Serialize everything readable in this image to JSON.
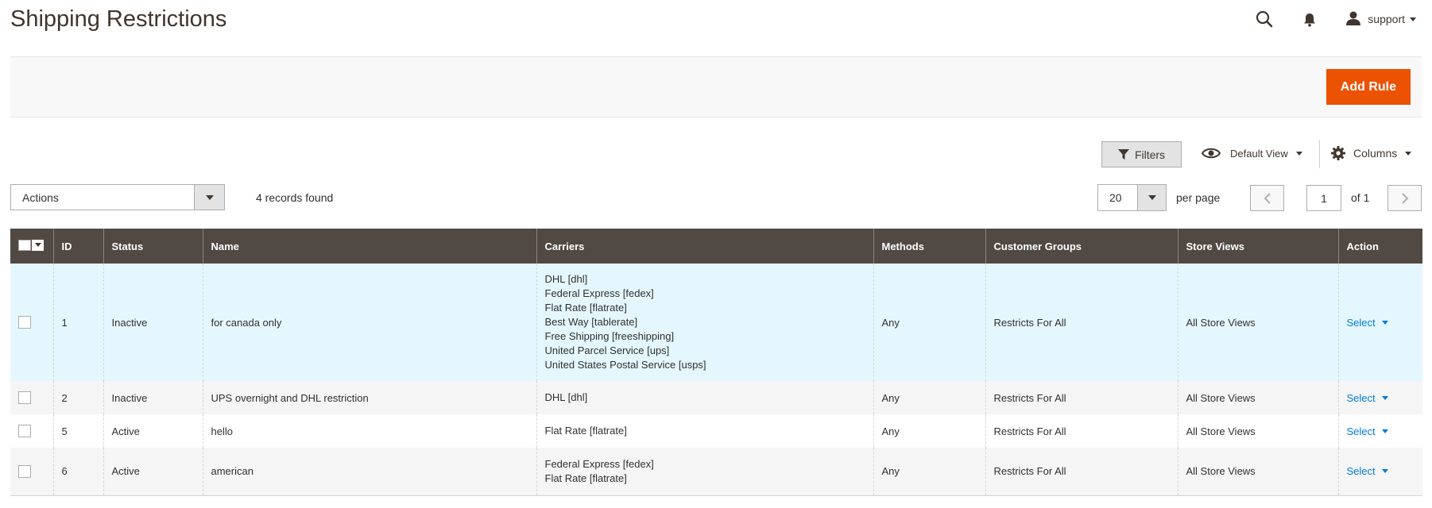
{
  "header": {
    "title": "Shipping Restrictions",
    "user_name": "support",
    "icons": {
      "search": "search-icon",
      "notifications": "bell-icon",
      "user": "user-icon"
    }
  },
  "page_actions": {
    "add_rule_label": "Add Rule"
  },
  "toolbar": {
    "filters_label": "Filters",
    "view_label": "Default View",
    "columns_label": "Columns",
    "actions_label": "Actions",
    "records_found": "4 records found",
    "per_page_value": "20",
    "per_page_label": "per page",
    "current_page": "1",
    "total_pages_label": "of 1"
  },
  "grid": {
    "columns": [
      "ID",
      "Status",
      "Name",
      "Carriers",
      "Methods",
      "Customer Groups",
      "Store Views",
      "Action"
    ],
    "rows": [
      {
        "id": "1",
        "status": "Inactive",
        "name": "for canada only",
        "carriers": [
          "DHL [dhl]",
          "Federal Express [fedex]",
          "Flat Rate [flatrate]",
          "Best Way [tablerate]",
          "Free Shipping [freeshipping]",
          "United Parcel Service [ups]",
          "United States Postal Service [usps]"
        ],
        "methods": "Any",
        "customer_groups": "Restricts For All",
        "store_views": "All Store Views",
        "action": "Select"
      },
      {
        "id": "2",
        "status": "Inactive",
        "name": "UPS overnight and DHL restriction",
        "carriers": [
          "DHL [dhl]"
        ],
        "methods": "Any",
        "customer_groups": "Restricts For All",
        "store_views": "All Store Views",
        "action": "Select"
      },
      {
        "id": "5",
        "status": "Active",
        "name": "hello",
        "carriers": [
          "Flat Rate [flatrate]"
        ],
        "methods": "Any",
        "customer_groups": "Restricts For All",
        "store_views": "All Store Views",
        "action": "Select"
      },
      {
        "id": "6",
        "status": "Active",
        "name": "american",
        "carriers": [
          "Federal Express [fedex]",
          "Flat Rate [flatrate]"
        ],
        "methods": "Any",
        "customer_groups": "Restricts For All",
        "store_views": "All Store Views",
        "action": "Select"
      }
    ]
  },
  "colors": {
    "accent": "#eb5202",
    "header_bg": "#514943",
    "link": "#007bdb",
    "selected_row": "#e5f7fe"
  }
}
